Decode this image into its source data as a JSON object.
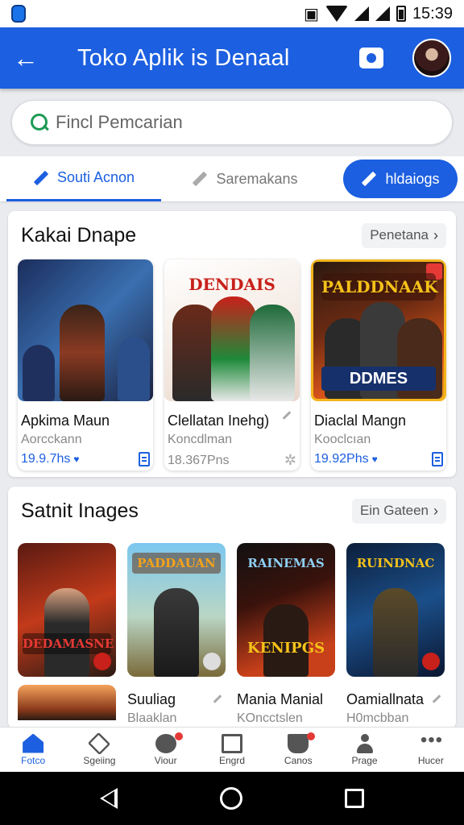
{
  "status_bar": {
    "time": "15:39"
  },
  "app_bar": {
    "title": "Toko Aplik is Denaal",
    "back_icon": "arrow-left-icon",
    "camera_icon": "camera-icon",
    "avatar_icon": "user-avatar"
  },
  "search": {
    "placeholder": "Fincl Pemcarian"
  },
  "tabs": [
    {
      "label": "Souti Acnon",
      "icon": "pencil-icon",
      "state": "active"
    },
    {
      "label": "Saremakans",
      "icon": "pencil-icon",
      "state": "inactive"
    },
    {
      "label": "hldaiogs",
      "icon": "pencil-icon",
      "state": "pill"
    }
  ],
  "section1": {
    "title": "Kakai Dnape",
    "see_all": "Penetana",
    "apps": [
      {
        "name": "Apkima Maun",
        "developer": "Aorcckann",
        "meta": "19.9.7hs",
        "meta_icon": "twitter-icon",
        "action_icon": "document-icon",
        "logo": ""
      },
      {
        "name": "Clellatan Inehg)",
        "developer": "Koncdlman",
        "meta": "18.367Pns",
        "meta_icon": "",
        "action_icon": "gear-icon",
        "logo": "DENDAIS"
      },
      {
        "name": "Diaclal Mangn",
        "developer": "Kooclcıan",
        "meta": "19.92Phs",
        "meta_icon": "twitter-icon",
        "action_icon": "document-icon",
        "logo": "PALDDNAAK",
        "banner": "DDMES"
      }
    ]
  },
  "section2": {
    "title": "Satnit Inages",
    "see_all": "Ein Gateen",
    "thumbs": [
      {
        "logo": "DEDAMASNE"
      },
      {
        "logo": "PADDAUAN"
      },
      {
        "logo": "RAINEMAS",
        "banner": "KENIPGS"
      },
      {
        "logo": "RUINDNAC"
      }
    ],
    "apps": [
      {
        "name": "",
        "developer": ""
      },
      {
        "name": "Suuliag",
        "developer": "Blaaklan"
      },
      {
        "name": "Mania Manial",
        "developer": "KOncctslen"
      },
      {
        "name": "Oamiallnata",
        "developer": "H0mcbban"
      }
    ]
  },
  "bottom_nav": [
    {
      "label": "Fotco",
      "icon": "home-icon",
      "active": true,
      "badge": false
    },
    {
      "label": "Sgeiing",
      "icon": "diamond-icon",
      "active": false,
      "badge": false
    },
    {
      "label": "Viour",
      "icon": "compass-icon",
      "active": false,
      "badge": true
    },
    {
      "label": "Engrd",
      "icon": "book-icon",
      "active": false,
      "badge": false
    },
    {
      "label": "Canos",
      "icon": "cart-icon",
      "active": false,
      "badge": true
    },
    {
      "label": "Prage",
      "icon": "person-icon",
      "active": false,
      "badge": false
    },
    {
      "label": "Hucer",
      "icon": "more-icon",
      "active": false,
      "badge": false
    }
  ],
  "colors": {
    "primary": "#1c5fe0",
    "accent_green": "#1e9a55",
    "badge_red": "#e53935"
  }
}
